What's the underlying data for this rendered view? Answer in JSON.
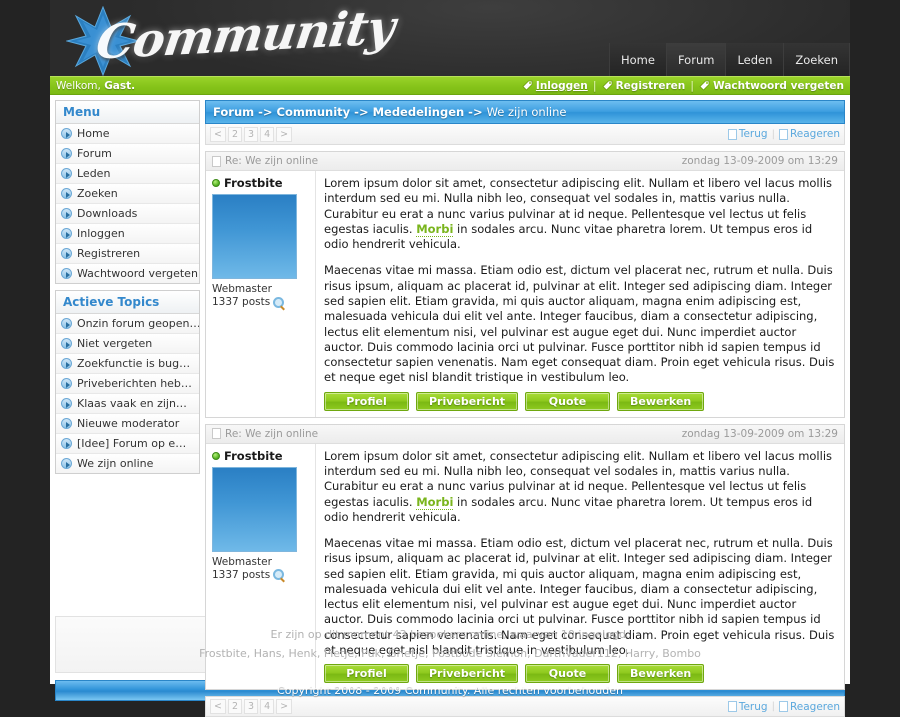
{
  "site": {
    "logo_text": "Community",
    "logo_icon": "star-burst-icon"
  },
  "topnav": [
    {
      "label": "Home",
      "active": false
    },
    {
      "label": "Forum",
      "active": true
    },
    {
      "label": "Leden",
      "active": false
    },
    {
      "label": "Zoeken",
      "active": false
    }
  ],
  "greenbar": {
    "welcome_prefix": "Welkom, ",
    "welcome_user": "Gast.",
    "login": "Inloggen",
    "register": "Registreren",
    "forgot": "Wachtwoord vergeten",
    "separator": "|",
    "accent": "#8cc81c"
  },
  "sidebar": {
    "menu": {
      "title": "Menu",
      "items": [
        {
          "label": "Home"
        },
        {
          "label": "Forum"
        },
        {
          "label": "Leden"
        },
        {
          "label": "Zoeken"
        },
        {
          "label": "Downloads"
        },
        {
          "label": "Inloggen"
        },
        {
          "label": "Registreren"
        },
        {
          "label": "Wachtwoord vergeten"
        }
      ]
    },
    "active_topics": {
      "title": "Actieve Topics",
      "items": [
        {
          "label": "Onzin forum geopen…"
        },
        {
          "label": "Niet vergeten"
        },
        {
          "label": "Zoekfunctie is bug…"
        },
        {
          "label": "Priveberichten heb…"
        },
        {
          "label": "Klaas vaak en zijn…"
        },
        {
          "label": "Nieuwe moderator"
        },
        {
          "label": "[Idee] Forum op e…"
        },
        {
          "label": "We zijn online"
        }
      ]
    }
  },
  "breadcrumb": {
    "path": "Forum -> Community -> Mededelingen -> ",
    "current": "We zijn online"
  },
  "pagination": {
    "prev": "<",
    "pages": [
      "2",
      "3",
      "4"
    ],
    "next": ">"
  },
  "topbar_actions": {
    "back": "Terug",
    "reply": "Reageren",
    "separator": "|"
  },
  "posts": [
    {
      "subject": "Re: We zijn online",
      "date": "zondag 13-09-2009 om 13:29",
      "author": "Frostbite",
      "author_online": true,
      "rank": "Webmaster",
      "postcount": "1337 posts",
      "paragraph1_a": "Lorem ipsum dolor sit amet, consectetur adipiscing elit. Nullam et libero vel lacus mollis interdum sed eu mi. Nulla nibh leo, consequat vel sodales in, mattis varius nulla. Curabitur eu erat a nunc varius pulvinar at id neque. Pellentesque vel lectus ut felis egestas iaculis. ",
      "paragraph1_link": "Morbi",
      "paragraph1_b": " in sodales arcu. Nunc vitae pharetra lorem. Ut tempus eros id odio hendrerit vehicula.",
      "paragraph2": "Maecenas vitae mi massa. Etiam odio est, dictum vel placerat nec, rutrum et nulla. Duis risus ipsum, aliquam ac placerat id, pulvinar at elit. Integer sed adipiscing diam. Integer sed sapien elit. Etiam gravida, mi quis auctor aliquam, magna enim adipiscing est, malesuada vehicula dui elit vel ante. Integer faucibus, diam a consectetur adipiscing, lectus elit elementum nisi, vel pulvinar est augue eget dui. Nunc imperdiet auctor auctor. Duis commodo lacinia orci ut pulvinar. Fusce porttitor nibh id sapien tempus id consectetur sapien venenatis. Nam eget consequat diam. Proin eget vehicula risus. Duis et neque eget nisl blandit tristique in vestibulum leo.",
      "buttons": [
        "Profiel",
        "Privebericht",
        "Quote",
        "Bewerken"
      ]
    },
    {
      "subject": "Re: We zijn online",
      "date": "zondag 13-09-2009 om 13:29",
      "author": "Frostbite",
      "author_online": true,
      "rank": "Webmaster",
      "postcount": "1337 posts",
      "paragraph1_a": "Lorem ipsum dolor sit amet, consectetur adipiscing elit. Nullam et libero vel lacus mollis interdum sed eu mi. Nulla nibh leo, consequat vel sodales in, mattis varius nulla. Curabitur eu erat a nunc varius pulvinar at id neque. Pellentesque vel lectus ut felis egestas iaculis. ",
      "paragraph1_link": "Morbi",
      "paragraph1_b": " in sodales arcu. Nunc vitae pharetra lorem. Ut tempus eros id odio hendrerit vehicula.",
      "paragraph2": "Maecenas vitae mi massa. Etiam odio est, dictum vel placerat nec, rutrum et nulla. Duis risus ipsum, aliquam ac placerat id, pulvinar at elit. Integer sed adipiscing diam. Integer sed sapien elit. Etiam gravida, mi quis auctor aliquam, magna enim adipiscing est, malesuada vehicula dui elit vel ante. Integer faucibus, diam a consectetur adipiscing, lectus elit elementum nisi, vel pulvinar est augue eget dui. Nunc imperdiet auctor auctor. Duis commodo lacinia orci ut pulvinar. Fusce porttitor nibh id sapien tempus id consectetur sapien venenatis. Nam eget consequat diam. Proin eget vehicula risus. Duis et neque eget nisl blandit tristique in vestibulum leo.",
      "buttons": [
        "Profiel",
        "Privebericht",
        "Quote",
        "Bewerken"
      ]
    }
  ],
  "footer": {
    "online_line": "Er zijn op dit moment 43 bezoekers online, waarvan 10 ingelogd.",
    "online_users": "Frostbite, Hans, Henk, Pietje, Puk, Grietje, Postbode Siemon, DarthVader112, Harry, Bombo",
    "copyright": "Copyright 2008 - 2009 Community. Alle rechten voorbehouden"
  },
  "colors": {
    "green": "#8cc81c",
    "blue": "#2f93d8",
    "dark": "#232323",
    "link_blue": "#5ba8dd",
    "title_blue": "#3388cc"
  }
}
